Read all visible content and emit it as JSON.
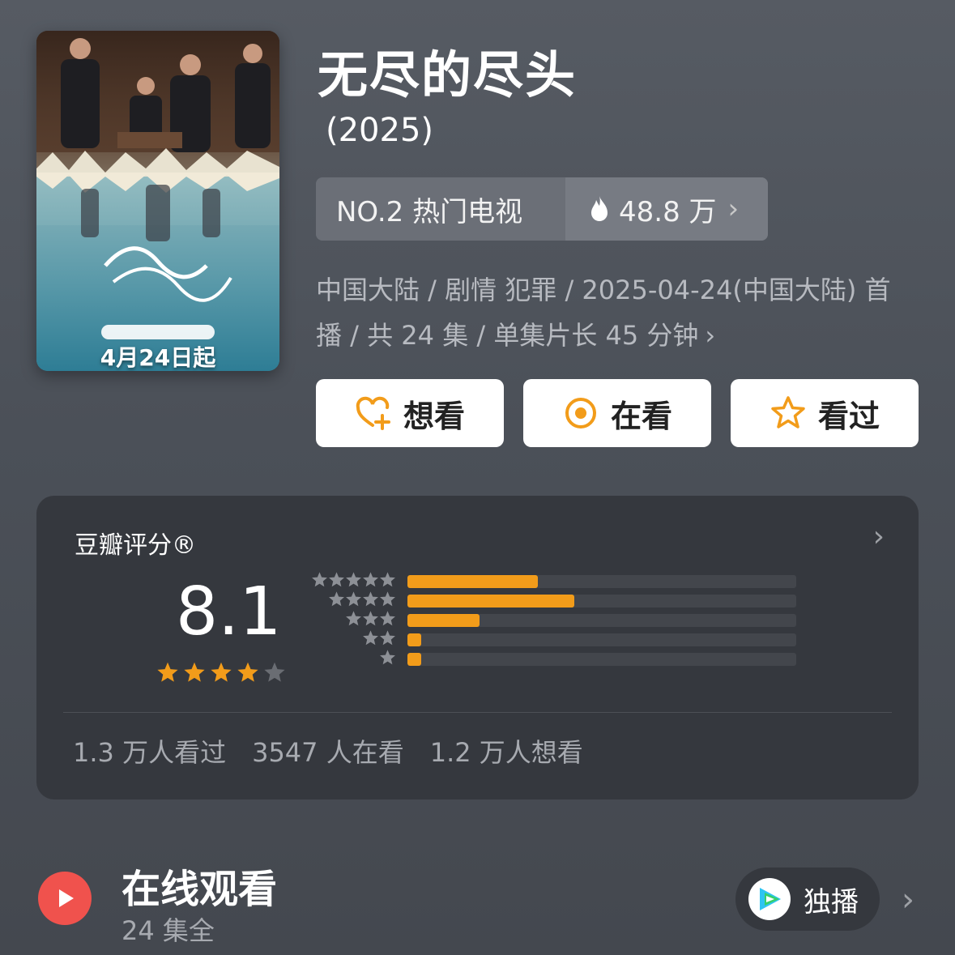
{
  "poster": {
    "date_text": "4月24日起"
  },
  "title": "无尽的尽头",
  "year": "(2025)",
  "rank": {
    "label": "NO.2 热门电视",
    "heat": "48.8 万",
    "flame_icon": "flame-icon",
    "chevron": "›"
  },
  "meta": {
    "line1": "中国大陆 / 剧情 犯罪 / 2025-04-24(中国大陆) 首",
    "line2": "播 / 共 24 集 / 单集片长 45 分钟",
    "chevron": "›"
  },
  "actions": [
    {
      "label": "想看",
      "icon": "heart-plus-icon"
    },
    {
      "label": "在看",
      "icon": "radio-dot-icon"
    },
    {
      "label": "看过",
      "icon": "star-outline-icon"
    }
  ],
  "rating": {
    "title": "豆瓣评分®",
    "chevron": "›",
    "score": "8.1",
    "stars_filled": 4,
    "stars_total": 5,
    "distribution": [
      {
        "stars": 5,
        "fraction": 0.335
      },
      {
        "stars": 4,
        "fraction": 0.43
      },
      {
        "stars": 3,
        "fraction": 0.185
      },
      {
        "stars": 2,
        "fraction": 0.035
      },
      {
        "stars": 1,
        "fraction": 0.035
      }
    ],
    "stats": {
      "watched": "1.3 万人看过",
      "watching": "3547 人在看",
      "want": "1.2 万人想看"
    }
  },
  "online": {
    "title": "在线观看",
    "subtitle": "24 集全",
    "platform_label": "独播",
    "chevron": "›"
  },
  "colors": {
    "accent": "#f29c1a",
    "play_red": "#f0524d",
    "background": "#4b5058",
    "card": "#35383e"
  }
}
